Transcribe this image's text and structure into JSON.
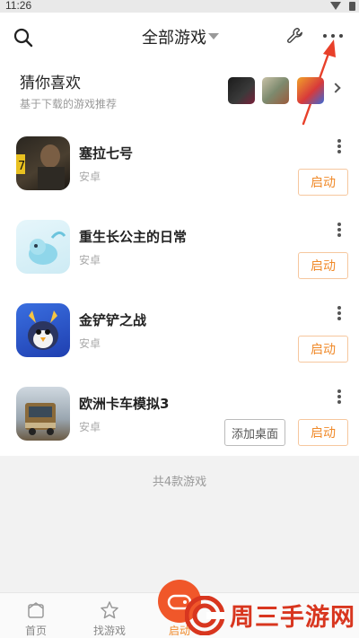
{
  "status_bar": {
    "time": "11:26"
  },
  "header": {
    "title": "全部游戏"
  },
  "recommend": {
    "title": "猜你喜欢",
    "subtitle": "基于下载的游戏推荐"
  },
  "games": [
    {
      "name": "塞拉七号",
      "platform": "安卓",
      "launch_label": "启动"
    },
    {
      "name": "重生长公主的日常",
      "platform": "安卓",
      "launch_label": "启动"
    },
    {
      "name": "金铲铲之战",
      "platform": "安卓",
      "launch_label": "启动"
    },
    {
      "name": "欧洲卡车模拟3",
      "platform": "安卓",
      "launch_label": "启动",
      "add_desktop_label": "添加桌面"
    }
  ],
  "footer": {
    "count_text": "共4款游戏"
  },
  "tabs": [
    {
      "label": "首页"
    },
    {
      "label": "找游戏"
    },
    {
      "label": "启动"
    }
  ],
  "watermark": {
    "text": "周三手游网"
  },
  "colors": {
    "accent": "#f08a2a",
    "annotation_arrow": "#e8402a",
    "watermark": "#d8361f"
  }
}
